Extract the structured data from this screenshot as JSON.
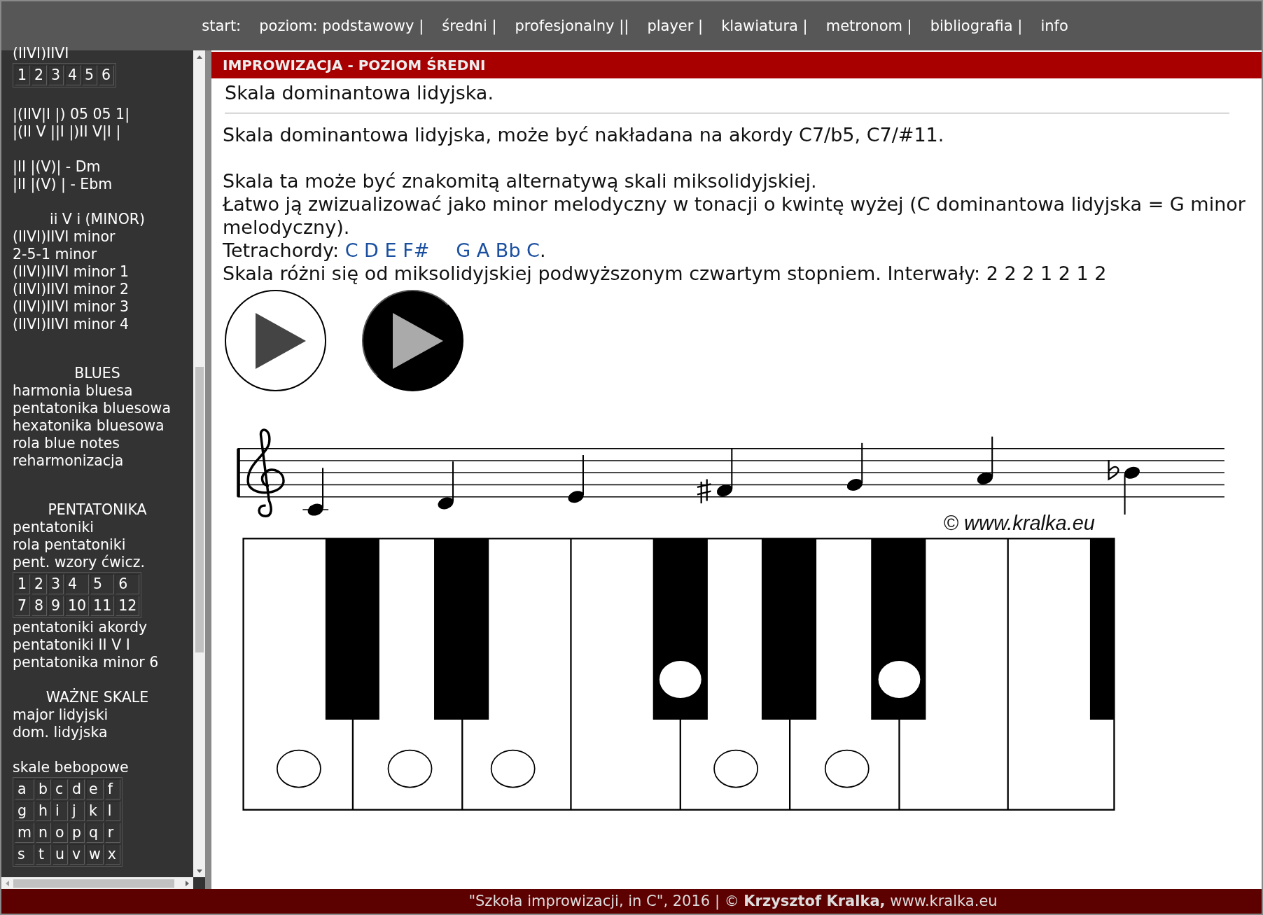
{
  "nav": {
    "label": "start:",
    "links": [
      "poziom: podstawowy |",
      "średni |",
      "profesjonalny ||",
      "player |",
      "klawiatura |",
      "metronom |",
      "bibliografia |",
      "info"
    ]
  },
  "sidebar": {
    "sections": [
      {
        "entries": [
          {
            "kind": "link",
            "text": "(IIVI)IIVI"
          },
          {
            "kind": "grid",
            "rows": [
              [
                "1",
                "2",
                "3",
                "4",
                "5",
                "6"
              ]
            ]
          }
        ]
      },
      {
        "entries": [
          {
            "kind": "link",
            "text": "|(IIV|I |) 05 05 1|"
          },
          {
            "kind": "link",
            "text": "|(II V ||I |)II V|I |"
          }
        ]
      },
      {
        "entries": [
          {
            "kind": "link",
            "text": "|II |(V)| - Dm"
          },
          {
            "kind": "link",
            "text": "|II |(V) | - Ebm"
          }
        ]
      },
      {
        "entries": [
          {
            "kind": "heading",
            "text": "ii V i (MINOR)"
          },
          {
            "kind": "link",
            "text": "(IIVI)IIVI minor"
          },
          {
            "kind": "link",
            "text": "2-5-1 minor"
          },
          {
            "kind": "link",
            "text": "(IIVI)IIVI minor 1"
          },
          {
            "kind": "link",
            "text": "(IIVI)IIVI minor 2"
          },
          {
            "kind": "link",
            "text": "(IIVI)IIVI minor 3"
          },
          {
            "kind": "link",
            "text": "(IIVI)IIVI minor 4"
          }
        ]
      },
      {
        "entries": [
          {
            "kind": "heading",
            "text": "BLUES"
          },
          {
            "kind": "link",
            "text": "harmonia bluesa"
          },
          {
            "kind": "link",
            "text": "pentatonika bluesowa"
          },
          {
            "kind": "link",
            "text": "hexatonika bluesowa"
          },
          {
            "kind": "link",
            "text": "rola blue notes"
          },
          {
            "kind": "link",
            "text": "reharmonizacja"
          }
        ]
      },
      {
        "entries": [
          {
            "kind": "heading",
            "text": "PENTATONIKA"
          },
          {
            "kind": "link",
            "text": "pentatoniki"
          },
          {
            "kind": "link",
            "text": "rola pentatoniki"
          },
          {
            "kind": "link",
            "text": "pent. wzory ćwicz."
          },
          {
            "kind": "grid",
            "rows": [
              [
                "1",
                "2",
                "3",
                "4",
                "5",
                "6"
              ],
              [
                "7",
                "8",
                "9",
                "10",
                "11",
                "12"
              ]
            ]
          },
          {
            "kind": "link",
            "text": "pentatoniki akordy"
          },
          {
            "kind": "link",
            "text": "pentatoniki II V I"
          },
          {
            "kind": "link",
            "text": "pentatonika minor 6"
          }
        ]
      },
      {
        "entries": [
          {
            "kind": "heading",
            "text": "WAŻNE SKALE"
          },
          {
            "kind": "link",
            "text": "major lidyjski"
          },
          {
            "kind": "link",
            "text": "dom. lidyjska"
          }
        ]
      },
      {
        "entries": [
          {
            "kind": "link",
            "text": "skale bebopowe"
          },
          {
            "kind": "grid",
            "rows": [
              [
                "a",
                "b",
                "c",
                "d",
                "e",
                "f"
              ],
              [
                "g",
                "h",
                "i",
                "j",
                "k",
                "l"
              ],
              [
                "m",
                "n",
                "o",
                "p",
                "q",
                "r"
              ],
              [
                "s",
                "t",
                "u",
                "v",
                "w",
                "x"
              ]
            ]
          }
        ]
      }
    ]
  },
  "header": {
    "title": "IMPROWIZACJA - POZIOM ŚREDNI"
  },
  "content": {
    "subtitle": "Skala dominantowa lidyjska.",
    "paragraphs": [
      {
        "lines": [
          {
            "kind": "text",
            "text": "Skala dominantowa lidyjska, może być nakładana na akordy C7/b5, C7/#11."
          }
        ]
      },
      {
        "lines": [
          {
            "kind": "text",
            "text": "Skala ta może być znakomitą alternatywą skali miksolidyjskiej."
          },
          {
            "kind": "text",
            "text": "Łatwo ją zwizualizować jako minor melodyczny w tonacji o kwintę wyżej (C dominantowa lidyjska = G minor melodyczny)."
          },
          {
            "kind": "tetrachords",
            "label": "Tetrachordy:",
            "links": [
              "C D E F#",
              "G A Bb C"
            ],
            "end": "."
          },
          {
            "kind": "text",
            "text": "Skala różni się od miksolidyjskiej podwyższonym czwartym stopniem. Interwały: 2 2 2 1 2 1 2"
          }
        ]
      }
    ],
    "players": [
      {
        "kind": "light"
      },
      {
        "kind": "dark"
      }
    ],
    "copyright": "© www.kralka.eu"
  },
  "footer": "\"Szkoła improwizacji, in C\", 2016 | © **Krzysztof Kralka,** www.kralka.eu"
}
